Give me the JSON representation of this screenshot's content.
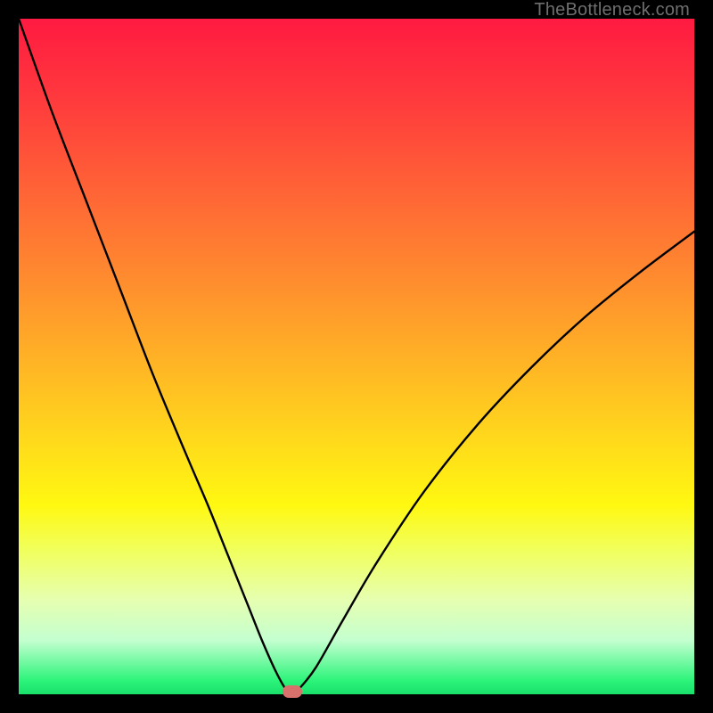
{
  "watermark": "TheBottleneck.com",
  "chart_data": {
    "type": "line",
    "title": "",
    "xlabel": "",
    "ylabel": "",
    "xlim": [
      0,
      100
    ],
    "ylim": [
      0,
      100
    ],
    "grid": false,
    "legend": false,
    "series": [
      {
        "name": "curve",
        "x": [
          0,
          5,
          10,
          15,
          20,
          25,
          28,
          31,
          34,
          36,
          38,
          39.5,
          40.5,
          41.5,
          44,
          48,
          53,
          60,
          68,
          76,
          84,
          92,
          100
        ],
        "y": [
          100,
          86,
          73,
          60,
          47,
          35,
          28,
          20.5,
          13,
          8,
          3.5,
          0.8,
          0,
          0.8,
          4,
          11,
          19.5,
          30,
          40,
          48.5,
          56,
          62.5,
          68.5
        ]
      }
    ],
    "marker": {
      "x": 40.5,
      "y": 0,
      "color": "#d8716b"
    },
    "gradient": {
      "stops": [
        {
          "pos": 0,
          "color": "#ff1a41"
        },
        {
          "pos": 50,
          "color": "#ffb126"
        },
        {
          "pos": 72,
          "color": "#fff811"
        },
        {
          "pos": 100,
          "color": "#18e06a"
        }
      ]
    }
  }
}
